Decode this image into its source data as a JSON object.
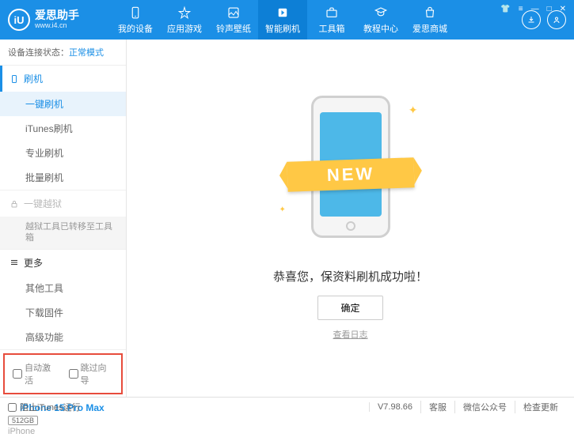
{
  "brand": {
    "name": "爱思助手",
    "url": "www.i4.cn",
    "logo_letter": "iU"
  },
  "nav": {
    "items": [
      {
        "label": "我的设备"
      },
      {
        "label": "应用游戏"
      },
      {
        "label": "铃声壁纸"
      },
      {
        "label": "智能刷机"
      },
      {
        "label": "工具箱"
      },
      {
        "label": "教程中心"
      },
      {
        "label": "爱思商城"
      }
    ],
    "active_index": 3
  },
  "sidebar": {
    "conn_label": "设备连接状态：",
    "conn_mode": "正常模式",
    "flash_header": "刷机",
    "flash_items": [
      "一键刷机",
      "iTunes刷机",
      "专业刷机",
      "批量刷机"
    ],
    "jailbreak_header": "一键越狱",
    "jailbreak_note": "越狱工具已转移至工具箱",
    "more_header": "更多",
    "more_items": [
      "其他工具",
      "下载固件",
      "高级功能"
    ],
    "chk_auto_activate": "自动激活",
    "chk_skip_guide": "跳过向导"
  },
  "device": {
    "name": "iPhone 15 Pro Max",
    "storage": "512GB",
    "type": "iPhone"
  },
  "content": {
    "banner": "NEW",
    "success": "恭喜您，保资料刷机成功啦！",
    "confirm": "确定",
    "log_link": "查看日志"
  },
  "statusbar": {
    "block_itunes": "阻止iTunes运行",
    "version": "V7.98.66",
    "items": [
      "客服",
      "微信公众号",
      "检查更新"
    ]
  }
}
